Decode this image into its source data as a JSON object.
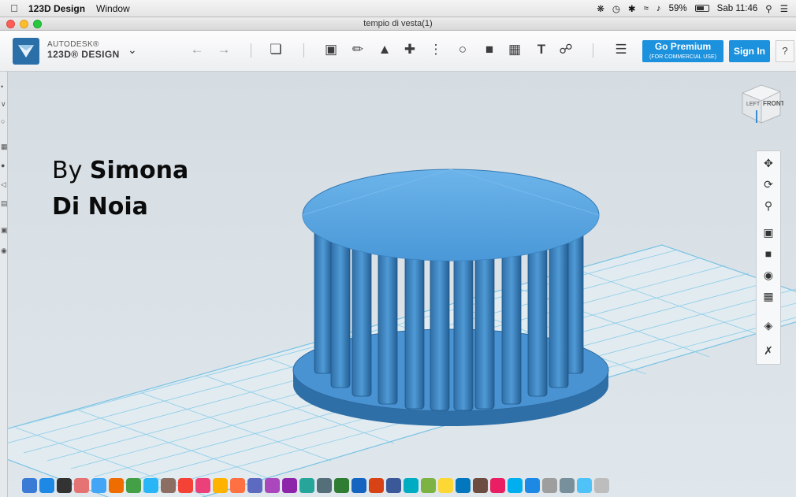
{
  "menubar": {
    "apple_icon": "apple-icon",
    "app_name": "123D Design",
    "menu_window": "Window",
    "battery_percent": "59%",
    "clock": "Sab 11:46"
  },
  "window": {
    "title": "tempio di vesta(1)"
  },
  "toolbar": {
    "brand_line1": "AUTODESK®",
    "brand_line2": "123D® DESIGN",
    "go_premium": "Go Premium",
    "go_premium_sub": "(FOR COMMERCIAL USE)",
    "sign_in": "Sign In",
    "help": "?",
    "text_tool": "T"
  },
  "viewcube": {
    "left": "LEFT",
    "front": "FRONT"
  },
  "overlay": {
    "credit_prefix": "By ",
    "credit_name_1": "Simona",
    "credit_name_2": "Di Noia"
  },
  "colors": {
    "accent": "#1c91dd",
    "model": "#3f8fd1",
    "grid": "#7fc8e8"
  }
}
